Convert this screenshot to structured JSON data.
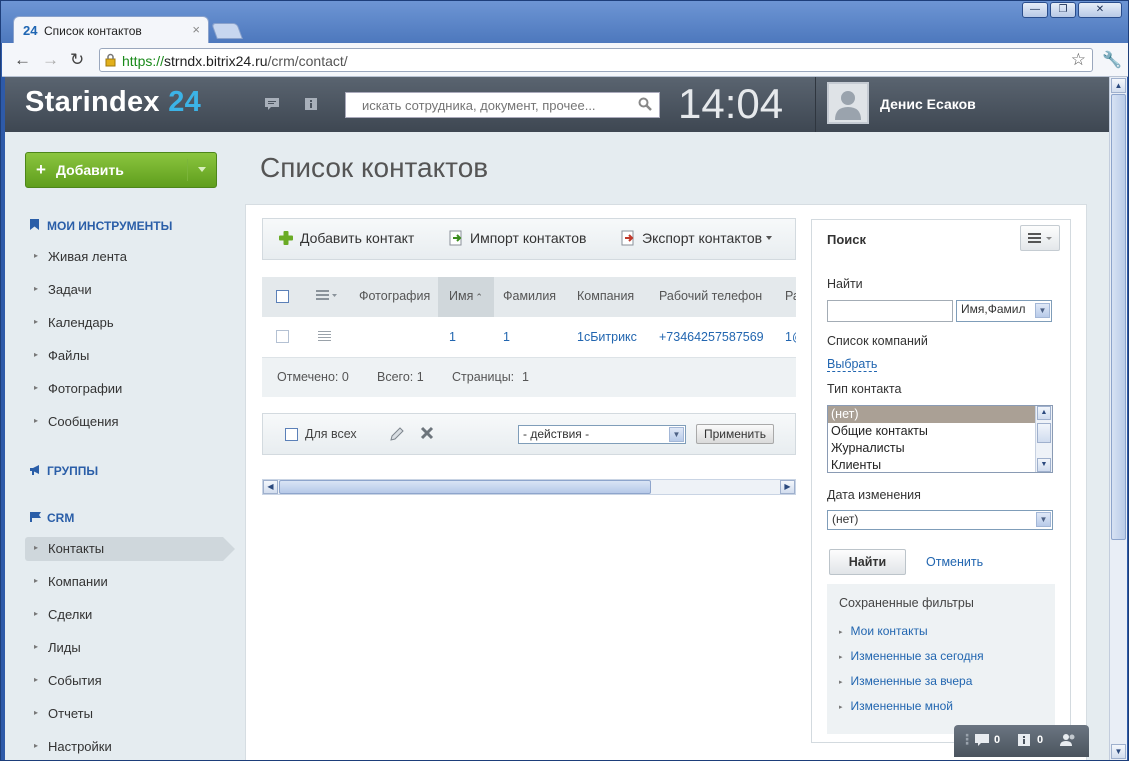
{
  "browser": {
    "tab_title": "Список контактов",
    "tab_fav": "24",
    "url_scheme": "https://",
    "url_domain": "strndx.bitrix24.ru",
    "url_path": "/crm/contact/"
  },
  "header": {
    "logo_main": "Starindex",
    "logo_num": "24",
    "search_placeholder": "искать сотрудника, документ, прочее...",
    "clock": "14:04",
    "user_name": "Денис Есаков"
  },
  "sidebar": {
    "add_button": "Добавить",
    "sections": {
      "tools": "МОИ ИНСТРУМЕНТЫ",
      "groups": "ГРУППЫ",
      "crm": "CRM"
    },
    "tools_items": [
      "Живая лента",
      "Задачи",
      "Календарь",
      "Файлы",
      "Фотографии",
      "Сообщения"
    ],
    "crm_items": [
      "Контакты",
      "Компании",
      "Сделки",
      "Лиды",
      "События",
      "Отчеты",
      "Настройки"
    ]
  },
  "main": {
    "page_title": "Список контактов",
    "toolbar": {
      "add_contact": "Добавить контакт",
      "import_contacts": "Импорт контактов",
      "export_contacts": "Экспорт контактов"
    },
    "grid": {
      "headers": [
        "Фотография",
        "Имя",
        "Фамилия",
        "Компания",
        "Рабочий телефон",
        "Ра"
      ],
      "row": {
        "name": "1",
        "surname": "1",
        "company": "1сБитрикс",
        "phone": "+73464257587569",
        "extra": "1@"
      },
      "footer": {
        "selected": "Отмечено: 0",
        "total": "Всего: 1",
        "pages": "Страницы:",
        "page_num": "1"
      }
    },
    "bulk": {
      "for_all": "Для всех",
      "actions_select": "- действия -",
      "apply": "Применить"
    }
  },
  "filter": {
    "title": "Поиск",
    "find_label": "Найти",
    "find_field_select": "Имя,Фамил",
    "companies_label": "Список компаний",
    "choose_link": "Выбрать",
    "contact_type_label": "Тип контакта",
    "contact_type_options": [
      "(нет)",
      "Общие контакты",
      "Журналисты",
      "Клиенты"
    ],
    "date_label": "Дата изменения",
    "date_select": "(нет)",
    "find_button": "Найти",
    "cancel_link": "Отменить",
    "saved_title": "Сохраненные фильтры",
    "saved_items": [
      "Мои контакты",
      "Измененные за сегодня",
      "Измененные за вчера",
      "Измененные мной"
    ]
  },
  "impanel": {
    "messages": "0",
    "notifications": "0"
  },
  "colors": {
    "brand_blue": "#3cb3e6",
    "add_green": "#6aab25",
    "link_blue": "#2266b0",
    "header_dark": "#4a535e"
  }
}
